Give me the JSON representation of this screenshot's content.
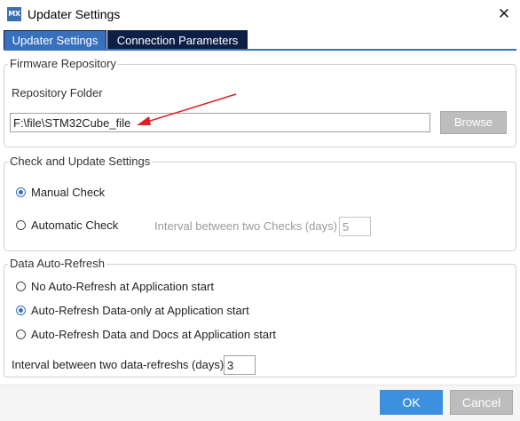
{
  "window": {
    "app_icon": "MX",
    "title": "Updater Settings",
    "close_glyph": "✕"
  },
  "tabs": [
    {
      "label": "Updater Settings",
      "active": true
    },
    {
      "label": "Connection Parameters",
      "active": false
    }
  ],
  "firmware": {
    "legend": "Firmware Repository",
    "folder_label": "Repository Folder",
    "folder_value": "F:\\file\\STM32Cube_file",
    "browse_label": "Browse"
  },
  "check": {
    "legend": "Check and Update Settings",
    "manual_label": "Manual Check",
    "manual_checked": true,
    "auto_label": "Automatic Check",
    "auto_checked": false,
    "interval_label": "Interval between two Checks (days)",
    "interval_value": "5"
  },
  "refresh": {
    "legend": "Data Auto-Refresh",
    "options": [
      {
        "label": "No Auto-Refresh at Application start",
        "checked": false
      },
      {
        "label": "Auto-Refresh Data-only at Application start",
        "checked": true
      },
      {
        "label": "Auto-Refresh Data and Docs at Application start",
        "checked": false
      }
    ],
    "interval_label": "Interval between two data-refreshs (days)",
    "interval_value": "3"
  },
  "buttons": {
    "ok_label": "OK",
    "cancel_label": "Cancel"
  },
  "colors": {
    "tab_active": "#3870be",
    "tab_inactive": "#0e1f47",
    "ok_button": "#3d8fe0",
    "annotation_arrow": "#e02020"
  }
}
